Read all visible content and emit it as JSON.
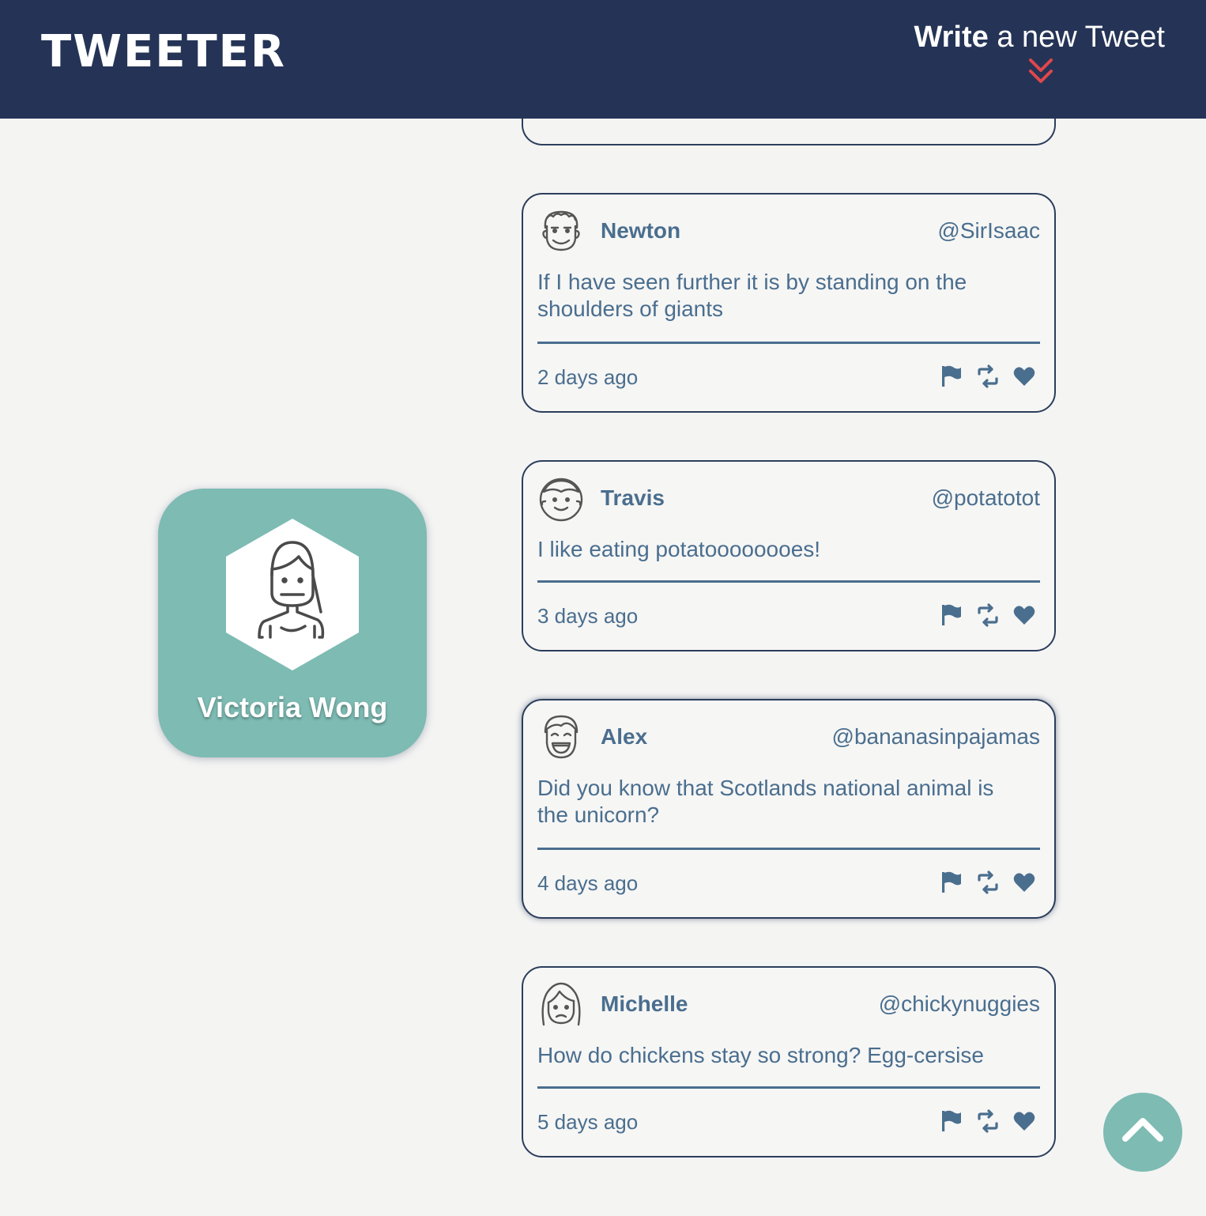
{
  "header": {
    "brand": "TWEETER",
    "compose_strong": "Write",
    "compose_rest": " a new Tweet",
    "compose_arrow_icon": "double-chevron-down",
    "colors": {
      "bar": "#253456",
      "arrow": "#e0474c"
    }
  },
  "profile": {
    "name": "Victoria Wong",
    "avatar_icon": "woman-avatar",
    "card_color": "#7dbbb3"
  },
  "tweets": [
    {
      "name": "Newton",
      "handle": "@SirIsaac",
      "text": "If I have seen further it is by standing on the shoulders of giants",
      "time": "2 days ago",
      "avatar_icon": "curly-hair-avatar"
    },
    {
      "name": "Travis",
      "handle": "@potatotot",
      "text": "I like eating potatoooooooes!",
      "time": "3 days ago",
      "avatar_icon": "boy-avatar"
    },
    {
      "name": "Alex",
      "handle": "@bananasinpajamas",
      "text": "Did you know that Scotlands national animal is the unicorn?",
      "time": "4 days ago",
      "avatar_icon": "laughing-avatar"
    },
    {
      "name": "Michelle",
      "handle": "@chickynuggies",
      "text": "How do chickens stay so strong? Egg-cersise",
      "time": "5 days ago",
      "avatar_icon": "girl-avatar"
    }
  ],
  "action_icons": [
    "flag-icon",
    "retweet-icon",
    "heart-icon"
  ],
  "scroll_top_icon": "chevron-up-icon"
}
